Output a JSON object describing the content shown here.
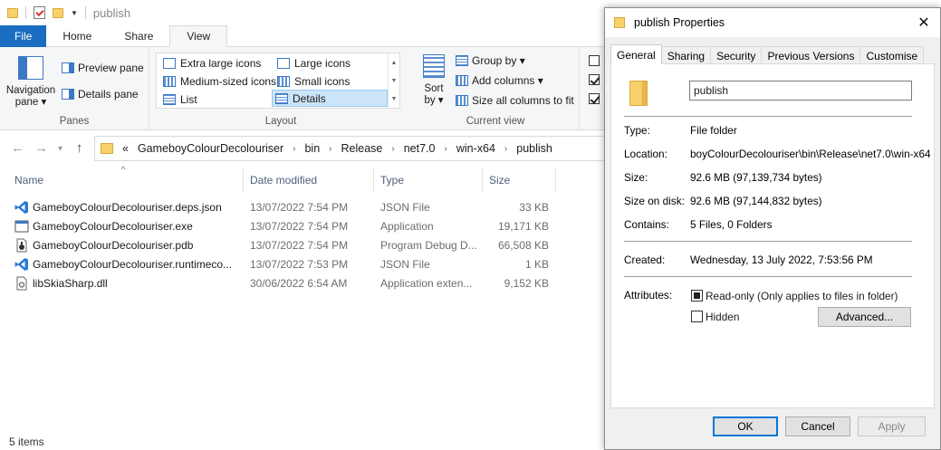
{
  "explorer": {
    "title": "publish",
    "tabs": [
      {
        "label": "File"
      },
      {
        "label": "Home"
      },
      {
        "label": "Share"
      },
      {
        "label": "View"
      }
    ],
    "ribbon": {
      "panes": {
        "label": "Panes",
        "navigation_pane": "Navigation",
        "navigation_pane_2": "pane ▾",
        "preview_pane": "Preview pane",
        "details_pane": "Details pane"
      },
      "layout": {
        "label": "Layout",
        "extra_large": "Extra large icons",
        "large": "Large icons",
        "medium": "Medium-sized icons",
        "small": "Small icons",
        "list": "List",
        "details": "Details"
      },
      "current_view": {
        "label": "Current view",
        "sort_by": "Sort",
        "sort_by_2": "by ▾",
        "group_by": "Group by ▾",
        "add_columns": "Add columns ▾",
        "size_all": "Size all columns to fit"
      }
    },
    "address": {
      "overflow": "«",
      "crumbs": [
        "GameboyColourDecolouriser",
        "bin",
        "Release",
        "net7.0",
        "win-x64",
        "publish"
      ]
    },
    "columns": {
      "name": "Name",
      "date": "Date modified",
      "type": "Type",
      "size": "Size"
    },
    "files": [
      {
        "name": "GameboyColourDecolouriser.deps.json",
        "date": "13/07/2022 7:54 PM",
        "type": "JSON File",
        "size": "33 KB",
        "icon": "vscode-json-icon"
      },
      {
        "name": "GameboyColourDecolouriser.exe",
        "date": "13/07/2022 7:54 PM",
        "type": "Application",
        "size": "19,171 KB",
        "icon": "application-exe-icon"
      },
      {
        "name": "GameboyColourDecolouriser.pdb",
        "date": "13/07/2022 7:54 PM",
        "type": "Program Debug D...",
        "size": "66,508 KB",
        "icon": "debug-pdb-icon"
      },
      {
        "name": "GameboyColourDecolouriser.runtimeco...",
        "date": "13/07/2022 7:53 PM",
        "type": "JSON File",
        "size": "1 KB",
        "icon": "vscode-json-icon"
      },
      {
        "name": "libSkiaSharp.dll",
        "date": "30/06/2022 6:54 AM",
        "type": "Application exten...",
        "size": "9,152 KB",
        "icon": "dll-icon"
      }
    ],
    "status": "5 items"
  },
  "properties": {
    "title": "publish Properties",
    "tabs": [
      "General",
      "Sharing",
      "Security",
      "Previous Versions",
      "Customise"
    ],
    "name": "publish",
    "info": [
      {
        "label": "Type:",
        "value": "File folder"
      },
      {
        "label": "Location:",
        "value": "boyColourDecolouriser\\bin\\Release\\net7.0\\win-x64"
      },
      {
        "label": "Size:",
        "value": "92.6 MB (97,139,734 bytes)"
      },
      {
        "label": "Size on disk:",
        "value": "92.6 MB (97,144,832 bytes)"
      },
      {
        "label": "Contains:",
        "value": "5 Files, 0 Folders"
      }
    ],
    "created": {
      "label": "Created:",
      "value": "Wednesday, 13 July 2022, 7:53:56 PM"
    },
    "attributes": {
      "label": "Attributes:",
      "readonly": "Read-only (Only applies to files in folder)",
      "hidden": "Hidden",
      "advanced": "Advanced..."
    },
    "buttons": {
      "ok": "OK",
      "cancel": "Cancel",
      "apply": "Apply"
    }
  },
  "colors": {
    "file_tab": "#1a6dc1",
    "folder": "#f8d16b",
    "selection": "#cce4f7",
    "vscode_blue": "#2b79d6"
  }
}
